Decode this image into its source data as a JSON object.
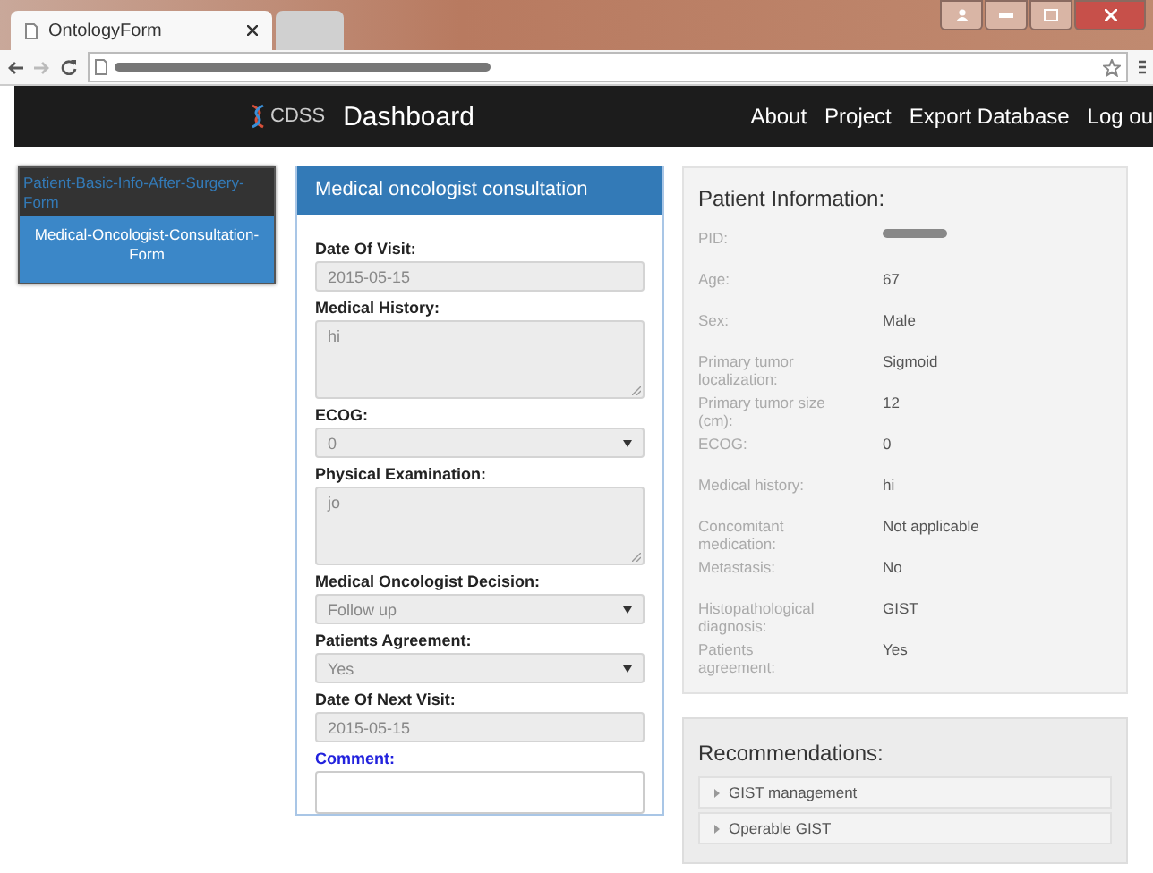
{
  "browser": {
    "tabs": [
      {
        "title": "OntologyForm",
        "selected": true
      },
      {
        "selected": false
      }
    ]
  },
  "navbar": {
    "brand": "CDSS",
    "title": "Dashboard",
    "links": [
      "About",
      "Project",
      "Export Database",
      "Log ou"
    ]
  },
  "sidebar": {
    "items": [
      {
        "label": "Patient-Basic-Info-After-Surgery-Form",
        "selected": false
      },
      {
        "label": "Medical-Oncologist-Consultation-Form",
        "selected": true
      }
    ]
  },
  "form": {
    "title": "Medical oncologist consultation",
    "fields": [
      {
        "kind": "input",
        "label": "Date Of Visit:",
        "value": "2015-05-15",
        "focused": false
      },
      {
        "kind": "textarea",
        "label": "Medical History:",
        "value": "hi",
        "focused": false
      },
      {
        "kind": "select",
        "label": "ECOG:",
        "value": "0",
        "focused": false
      },
      {
        "kind": "textarea",
        "label": "Physical Examination:",
        "value": "jo",
        "focused": false
      },
      {
        "kind": "select",
        "label": "Medical Oncologist Decision:",
        "value": "Follow up",
        "focused": false
      },
      {
        "kind": "select",
        "label": "Patients Agreement:",
        "value": "Yes",
        "focused": false
      },
      {
        "kind": "input",
        "label": "Date Of Next Visit:",
        "value": "2015-05-15",
        "focused": false
      },
      {
        "kind": "comment",
        "label": "Comment:",
        "focused": true
      }
    ]
  },
  "patient_info": {
    "title": "Patient Information:",
    "rows": [
      {
        "label": "PID:",
        "redacted": true
      },
      {
        "label": "Age:",
        "value": "67",
        "redacted": false
      },
      {
        "label": "Sex:",
        "value": "Male",
        "redacted": false
      },
      {
        "label": "Primary tumor localization:",
        "value": "Sigmoid",
        "redacted": false
      },
      {
        "label": "Primary tumor size (cm):",
        "value": "12",
        "redacted": false
      },
      {
        "label": "ECOG:",
        "value": "0",
        "redacted": false
      },
      {
        "label": "Medical history:",
        "value": "hi",
        "redacted": false
      },
      {
        "label": "Concomitant medication:",
        "value": "Not applicable",
        "redacted": false
      },
      {
        "label": "Metastasis:",
        "value": "No",
        "redacted": false
      },
      {
        "label": "Histopathological diagnosis:",
        "value": "GIST",
        "redacted": false
      },
      {
        "label": "Patients agreement:",
        "value": "Yes",
        "redacted": false
      }
    ]
  },
  "recommendations": {
    "title": "Recommendations:",
    "items": [
      {
        "label": "GIST management"
      },
      {
        "label": "Operable GIST"
      }
    ]
  }
}
